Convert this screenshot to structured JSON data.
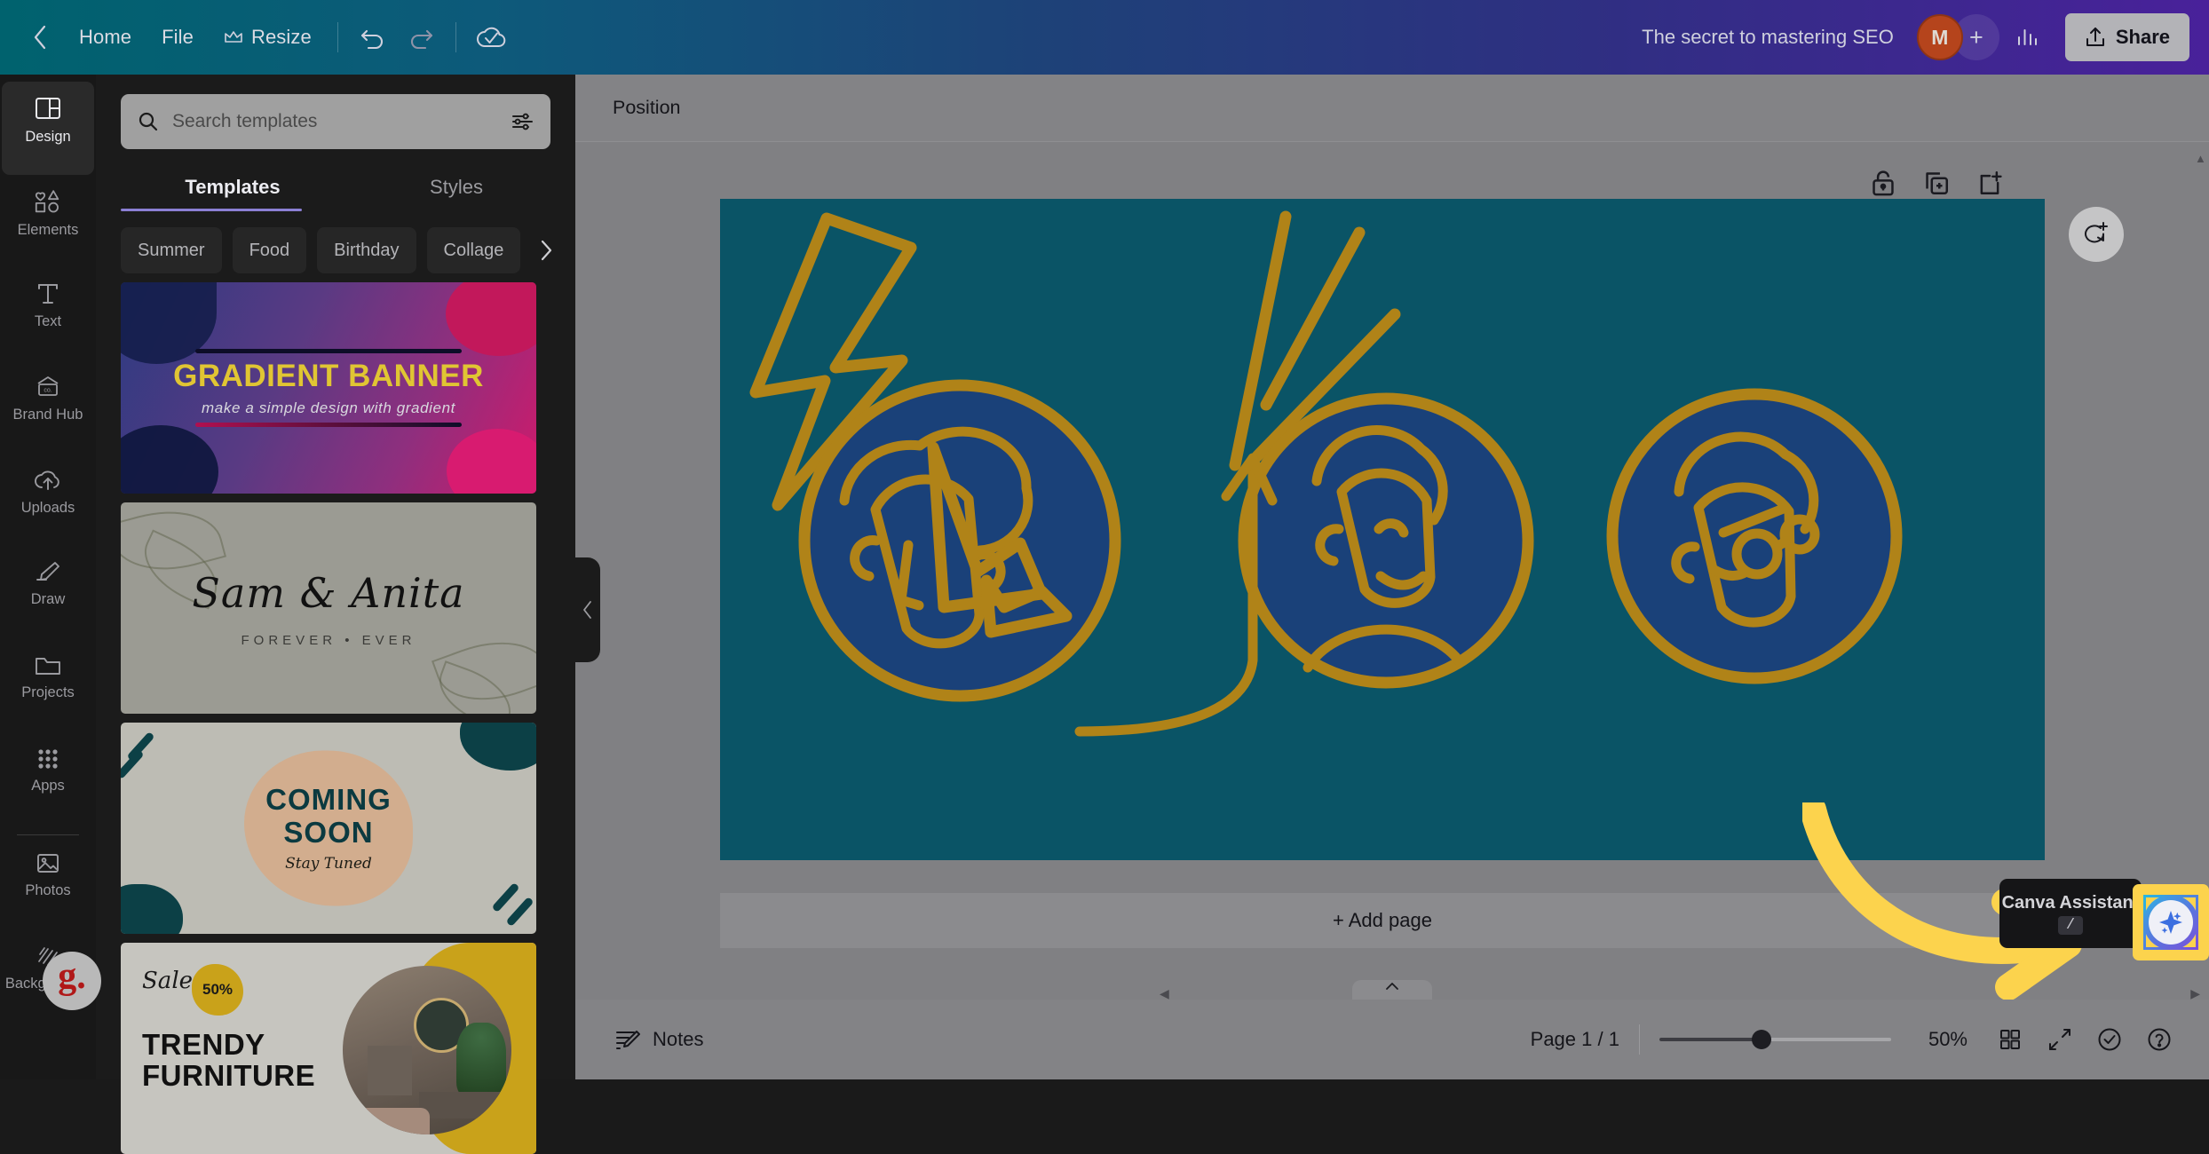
{
  "topbar": {
    "back_label": "",
    "home_label": "Home",
    "file_label": "File",
    "resize_label": "Resize",
    "undo_icon": "undo-icon",
    "redo_icon": "redo-icon",
    "cloud_status_icon": "cloud-saved-icon",
    "doc_title": "The secret to mastering SEO",
    "avatar_initial": "M",
    "add_collaborator_label": "+",
    "insights_icon": "insights-bar-chart-icon",
    "share_label": "Share"
  },
  "rail": {
    "items": [
      {
        "label": "Design",
        "icon": "design-layout-icon",
        "active": true
      },
      {
        "label": "Elements",
        "icon": "elements-shapes-icon",
        "active": false
      },
      {
        "label": "Text",
        "icon": "text-t-icon",
        "active": false
      },
      {
        "label": "Brand Hub",
        "icon": "brand-hub-card-icon",
        "active": false
      },
      {
        "label": "Uploads",
        "icon": "uploads-cloud-arrow-icon",
        "active": false
      },
      {
        "label": "Draw",
        "icon": "draw-pencil-icon",
        "active": false
      },
      {
        "label": "Projects",
        "icon": "projects-folder-icon",
        "active": false
      },
      {
        "label": "Apps",
        "icon": "apps-grid-icon",
        "active": false
      }
    ],
    "items_secondary": [
      {
        "label": "Photos",
        "icon": "photos-image-icon"
      },
      {
        "label": "Backgrounds",
        "icon": "backgrounds-hatch-icon"
      }
    ],
    "grammarly_badge": "g."
  },
  "panel": {
    "search": {
      "placeholder": "Search templates",
      "value": "",
      "icon": "search-icon",
      "filter_icon": "filter-sliders-icon"
    },
    "tabs": [
      {
        "label": "Templates",
        "active": true
      },
      {
        "label": "Styles",
        "active": false
      }
    ],
    "chips": [
      "Summer",
      "Food",
      "Birthday",
      "Collage"
    ],
    "chips_next_icon": "chevron-right-icon",
    "collapse_icon": "chevron-left-icon",
    "templates": [
      {
        "name": "gradient-banner",
        "title": "GRADIENT BANNER",
        "subtitle": "make a simple design with gradient"
      },
      {
        "name": "wedding-sam-anita",
        "title": "Sam & Anita",
        "subtitle": "FOREVER • EVER"
      },
      {
        "name": "coming-soon",
        "title_line1": "COMING",
        "title_line2": "SOON",
        "subtitle": "Stay Tuned"
      },
      {
        "name": "trendy-furniture",
        "sale_label": "Sale",
        "discount": "50%",
        "title_line1": "TRENDY",
        "title_line2": "FURNITURE"
      }
    ]
  },
  "editor": {
    "context_bar": {
      "position_label": "Position"
    },
    "page_tools": [
      {
        "icon": "lock-icon",
        "name": "lock-page-button"
      },
      {
        "icon": "duplicate-icon",
        "name": "duplicate-page-button"
      },
      {
        "icon": "add-page-icon",
        "name": "add-page-button"
      }
    ],
    "comment_icon": "add-comment-icon",
    "add_page_label": "+ Add page",
    "canvas": {
      "background_color": "#0a5466",
      "ink_color": "#b08318",
      "circle_fill": "#1a4179",
      "elements": [
        "lightning-bolt-doodle",
        "avatar-face-young-man",
        "avatar-face-woman",
        "avatar-face-elder-with-glasses",
        "speed-lines-doodle",
        "arrow-down-left-doodle",
        "curved-arrow-up-doodle"
      ]
    },
    "annotation_arrow_color": "#fcd34d"
  },
  "assistant": {
    "tooltip_title": "Canva Assistant",
    "tooltip_shortcut": "/",
    "button_icon": "sparkle-ai-icon",
    "highlight_color": "#fcd34d"
  },
  "bottombar": {
    "notes_label": "Notes",
    "notes_icon": "notes-pencil-icon",
    "page_indicator": "Page 1 / 1",
    "zoom_value": "50%",
    "grid_icon": "grid-view-icon",
    "fullscreen_icon": "expand-arrows-icon",
    "check_icon": "check-circle-icon",
    "help_icon": "help-question-icon",
    "collapse_icon": "chevron-up-icon"
  }
}
